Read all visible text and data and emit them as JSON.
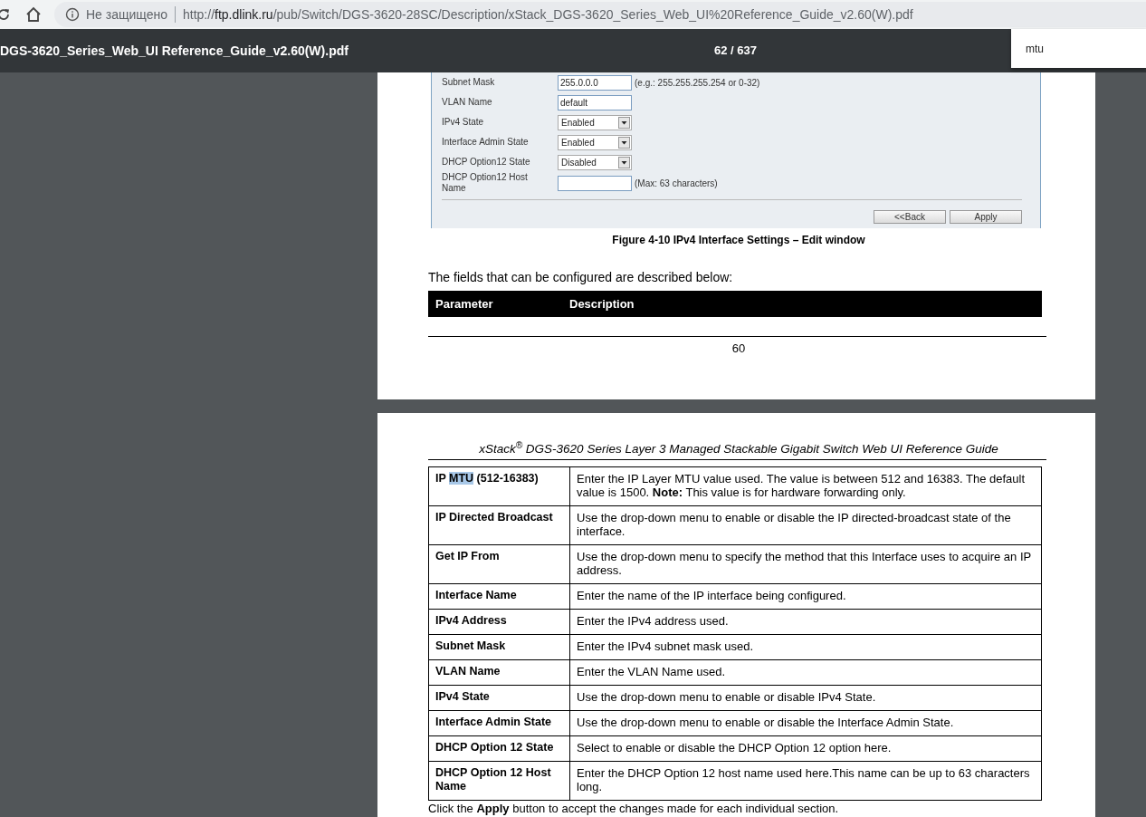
{
  "address_bar": {
    "security": "Не защищено",
    "url": {
      "scheme": "http://",
      "host": "ftp.dlink.ru",
      "path": "/pub/Switch/DGS-3620-28SC/Description/xStack_DGS-3620_Series_Web_UI%20Reference_Guide_v2.60(W).pdf"
    }
  },
  "pdf_toolbar": {
    "title": "DGS-3620_Series_Web_UI Reference_Guide_v2.60(W).pdf",
    "page_indicator": "62 / 637"
  },
  "find_box": {
    "value": "mtu"
  },
  "page_1": {
    "form": [
      {
        "label": "Subnet Mask",
        "kind": "text",
        "value": "255.0.0.0",
        "hint": "(e.g.: 255.255.255.254 or 0-32)"
      },
      {
        "label": "VLAN Name",
        "kind": "text",
        "value": "default"
      },
      {
        "label": "IPv4 State",
        "kind": "select",
        "value": "Enabled"
      },
      {
        "label": "Interface Admin State",
        "kind": "select",
        "value": "Enabled"
      },
      {
        "label": "DHCP Option12 State",
        "kind": "select",
        "value": "Disabled"
      },
      {
        "label": "DHCP Option12 Host Name",
        "kind": "text",
        "hint": "(Max: 63 characters)"
      }
    ],
    "buttons": [
      "<<Back",
      "Apply"
    ],
    "caption": "Figure 4-10 IPv4 Interface Settings – Edit window",
    "intro": "The fields that can be configured are described below:",
    "table_header": [
      "Parameter",
      "Description"
    ],
    "page_number": "60"
  },
  "page_2": {
    "header": "xStack$^{®}$ DGS-3620 Series Layer 3 Managed Stackable Gigabit Switch Web UI Reference Guide",
    "rows": [
      {
        "parameter": [
          {
            "text": "IP ",
            "highlighted": false
          },
          {
            "text": "MTU",
            "highlighted": true
          },
          {
            "text": " (512-16383)",
            "highlighted": false
          }
        ],
        "description": "Enter the IP Layer MTU value used. The value is between 512 and 16383. The default value is 1500. **Note:** This value is for hardware forwarding only."
      },
      {
        "parameter": [
          {
            "text": "IP Directed Broadcast",
            "highlighted": false
          }
        ],
        "description": "Use the drop-down menu to enable or disable the IP directed-broadcast state of the interface."
      },
      {
        "parameter": [
          {
            "text": "Get IP From",
            "highlighted": false
          }
        ],
        "description": "Use the drop-down menu to specify the method that this Interface uses to acquire an IP address."
      },
      {
        "parameter": [
          {
            "text": "Interface Name",
            "highlighted": false
          }
        ],
        "description": "Enter the name of the IP interface being configured."
      },
      {
        "parameter": [
          {
            "text": "IPv4 Address",
            "highlighted": false
          }
        ],
        "description": "Enter the IPv4 address used."
      },
      {
        "parameter": [
          {
            "text": "Subnet Mask",
            "highlighted": false
          }
        ],
        "description": "Enter the IPv4 subnet mask used."
      },
      {
        "parameter": [
          {
            "text": "VLAN Name",
            "highlighted": false
          }
        ],
        "description": "Enter the VLAN Name used."
      },
      {
        "parameter": [
          {
            "text": "IPv4 State",
            "highlighted": false
          }
        ],
        "description": "Use the drop-down menu to enable or disable IPv4 State."
      },
      {
        "parameter": [
          {
            "text": "Interface Admin State",
            "highlighted": false
          }
        ],
        "description": "Use the drop-down menu to enable or disable the Interface Admin State."
      },
      {
        "parameter": [
          {
            "text": "DHCP Option 12 State",
            "highlighted": false
          }
        ],
        "description": "Select to enable or disable the DHCP Option 12 option here."
      },
      {
        "parameter": [
          {
            "text": "DHCP Option 12 Host Name",
            "highlighted": false
          }
        ],
        "description": "Enter the DHCP Option 12 host name used here.This name can be up to 63 characters long."
      }
    ],
    "footer": "Click the **Apply** button to accept the changes made for each individual section."
  }
}
